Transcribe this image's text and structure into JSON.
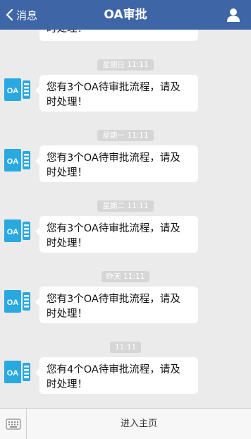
{
  "header": {
    "back_label": "消息",
    "title": "OA审批",
    "bg_color": "#3e66a6"
  },
  "messages": {
    "partial_first_text": "时处理！",
    "items": [
      {
        "time": "星期日 11:11",
        "line1": "您有3个OA待审批流程，请及",
        "line2": "时处理！"
      },
      {
        "time": "星期一 11:11",
        "line1": "您有3个OA待审批流程，请及",
        "line2": "时处理！"
      },
      {
        "time": "星期二 11:11",
        "line1": "您有3个OA待审批流程，请及",
        "line2": "时处理！"
      },
      {
        "time": "昨天 11:11",
        "line1": "您有3个OA待审批流程，请及",
        "line2": "时处理！"
      },
      {
        "time": "11:11",
        "line1": "您有4个OA待审批流程，请及",
        "line2": "时处理！"
      }
    ],
    "avatar_text": "OA",
    "avatar_icon": "oa-app-icon",
    "avatar_color": "#2aa9e0"
  },
  "footer": {
    "keyboard_icon": "keyboard-icon",
    "enter_home_label": "进入主页"
  }
}
